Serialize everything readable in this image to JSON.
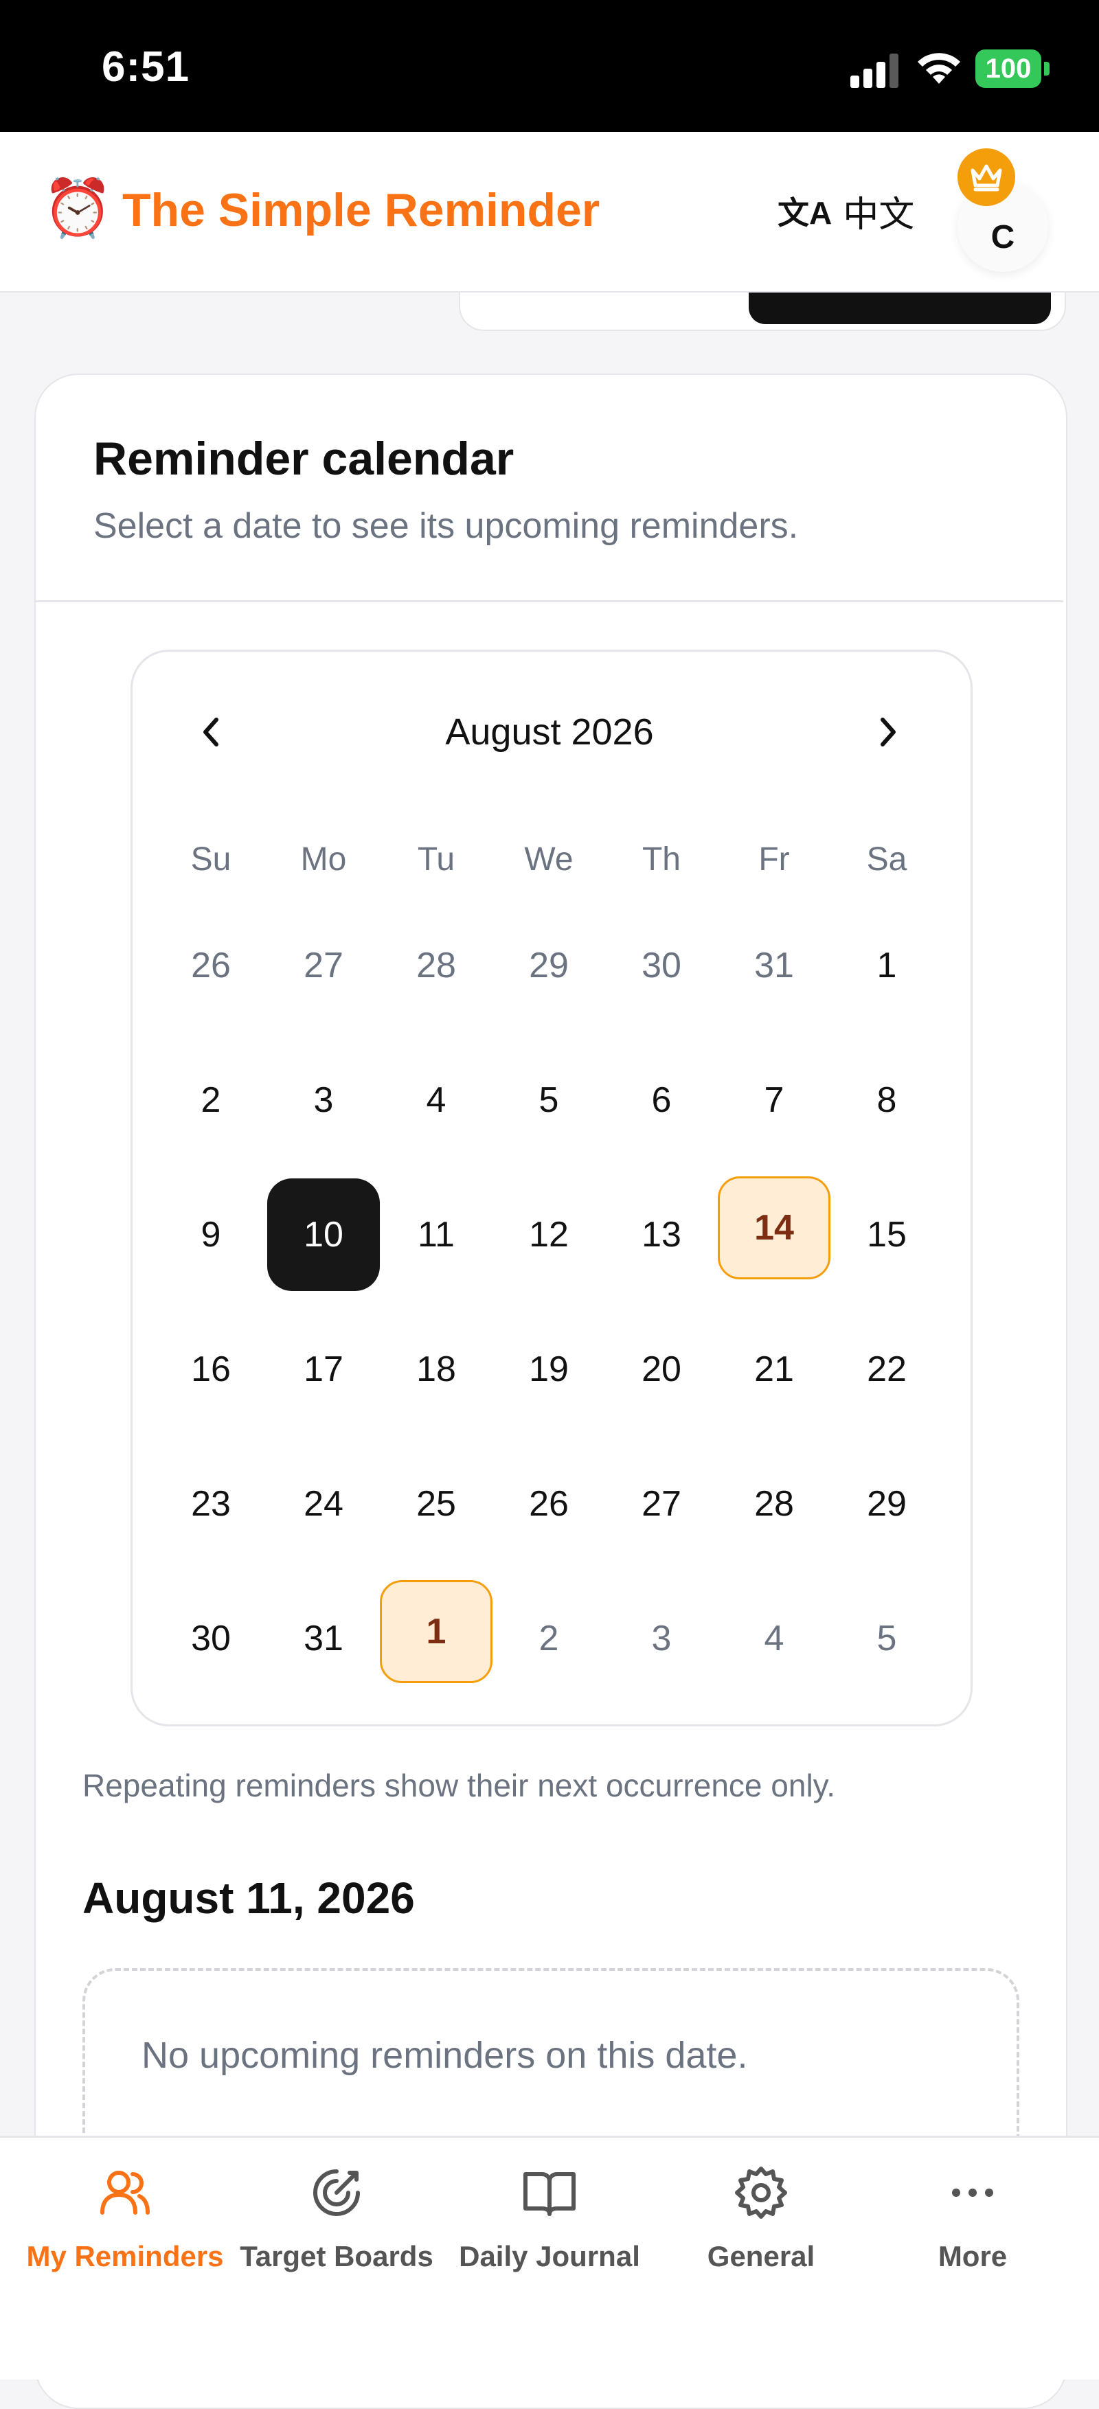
{
  "status_bar": {
    "time": "6:51",
    "battery": "100"
  },
  "header": {
    "logo_emoji": "⏰",
    "title": "The Simple Reminder",
    "lang_icon": "文A",
    "lang_label": "中文",
    "avatar_letter": "C",
    "badge_icon": "crown-icon"
  },
  "card": {
    "title": "Reminder calendar",
    "subtitle": "Select a date to see its upcoming reminders."
  },
  "calendar": {
    "month_label": "August 2026",
    "weekdays": [
      "Su",
      "Mo",
      "Tu",
      "We",
      "Th",
      "Fr",
      "Sa"
    ],
    "weeks": [
      [
        "26",
        "27",
        "28",
        "29",
        "30",
        "31",
        "1"
      ],
      [
        "2",
        "3",
        "4",
        "5",
        "6",
        "7",
        "8"
      ],
      [
        "9",
        "10",
        "11",
        "12",
        "13",
        "14",
        "15"
      ],
      [
        "16",
        "17",
        "18",
        "19",
        "20",
        "21",
        "22"
      ],
      [
        "23",
        "24",
        "25",
        "26",
        "27",
        "28",
        "29"
      ],
      [
        "30",
        "31",
        "1",
        "2",
        "3",
        "4",
        "5"
      ]
    ],
    "selected_day": "10",
    "reminder_days": [
      "14",
      "1 (September)"
    ]
  },
  "note": "Repeating reminders show their next occurrence only.",
  "selected_date_heading": "August 11, 2026",
  "empty_message": "No upcoming reminders on this date.",
  "bottom_nav": {
    "items": [
      {
        "label": "My Reminders",
        "icon": "users-icon",
        "active": true
      },
      {
        "label": "Target Boards",
        "icon": "target-icon",
        "active": false
      },
      {
        "label": "Daily Journal",
        "icon": "book-icon",
        "active": false
      },
      {
        "label": "General",
        "icon": "gear-icon",
        "active": false
      },
      {
        "label": "More",
        "icon": "more-icon",
        "active": false
      }
    ]
  },
  "colors": {
    "accent": "#f97316",
    "selected_day_bg": "#171717",
    "reminder_day_bg": "#ffedd5",
    "reminder_day_border": "#f59e0b"
  }
}
